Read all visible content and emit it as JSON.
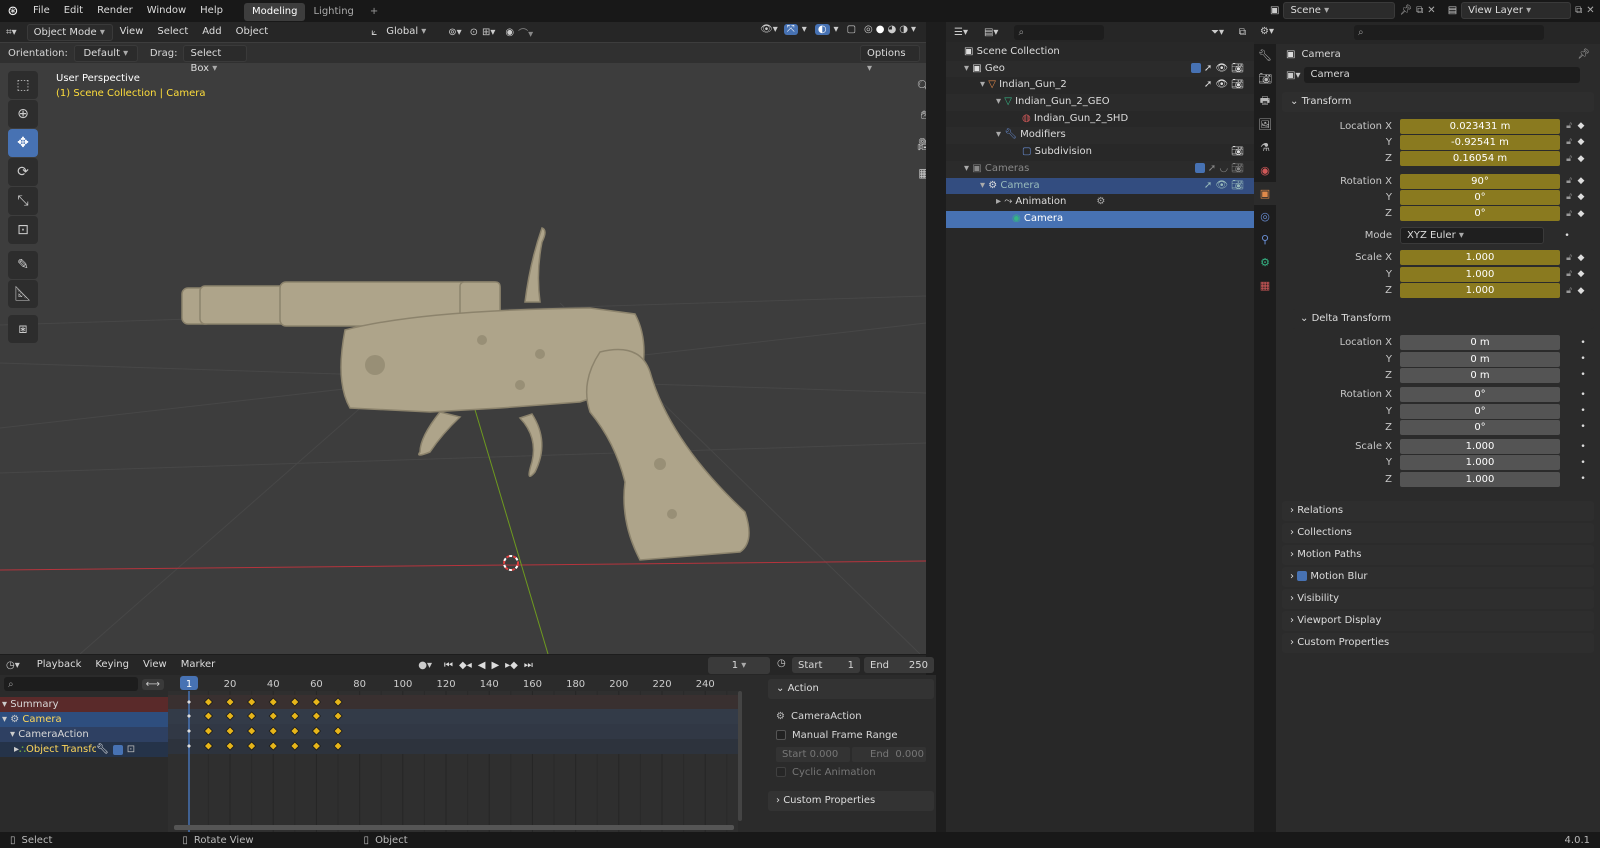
{
  "topbar": {
    "menus": [
      "File",
      "Edit",
      "Render",
      "Window",
      "Help"
    ],
    "tabs": [
      "Modeling",
      "Lighting"
    ],
    "add_tab": "+",
    "scene": "Scene",
    "view_layer": "View Layer"
  },
  "viewport": {
    "mode": "Object Mode",
    "menus": [
      "View",
      "Select",
      "Add",
      "Object"
    ],
    "transform_orientation": "Global",
    "orientation_label": "Orientation:",
    "orientation_value": "Default",
    "drag_label": "Drag:",
    "drag_value": "Select Box",
    "options": "Options",
    "overlay_title": "User Perspective",
    "overlay_sub_a": "(1) Scene Collection",
    "overlay_sub_sep": "|",
    "overlay_sub_b": "Camera"
  },
  "timeline": {
    "menus": [
      "Playback",
      "Keying",
      "View",
      "Marker"
    ],
    "current_frame": "1",
    "start_label": "Start",
    "start_value": "1",
    "end_label": "End",
    "end_value": "250",
    "ruler": [
      "20",
      "40",
      "60",
      "80",
      "100",
      "120",
      "140",
      "160",
      "180",
      "200",
      "220",
      "240"
    ],
    "playhead": "1",
    "channels": [
      "Summary",
      "Camera",
      "CameraAction",
      "Object Transforms"
    ],
    "action_panel": {
      "title": "Action",
      "action_name": "CameraAction",
      "manual_frame_range": "Manual Frame Range",
      "start_label": "Start",
      "start_value": "0.000",
      "end_label": "End",
      "end_value": "0.000",
      "cyclic": "Cyclic Animation",
      "custom_props": "Custom Properties"
    }
  },
  "outliner": {
    "rows": [
      {
        "label": "Scene Collection",
        "indent": 0
      },
      {
        "label": "Geo",
        "indent": 1
      },
      {
        "label": "Indian_Gun_2",
        "indent": 2
      },
      {
        "label": "Indian_Gun_2_GEO",
        "indent": 3
      },
      {
        "label": "Indian_Gun_2_SHD",
        "indent": 4
      },
      {
        "label": "Modifiers",
        "indent": 3
      },
      {
        "label": "Subdivision",
        "indent": 4
      },
      {
        "label": "Cameras",
        "indent": 1
      },
      {
        "label": "Camera",
        "indent": 2
      },
      {
        "label": "Animation",
        "indent": 3
      },
      {
        "label": "Camera",
        "indent": 3
      }
    ]
  },
  "properties": {
    "object_name": "Camera",
    "name_field": "Camera",
    "transform": {
      "title": "Transform",
      "location_label": "Location X",
      "location": [
        "0.023431 m",
        "-0.92541 m",
        "0.16054 m"
      ],
      "rotation_label": "Rotation X",
      "rotation": [
        "90°",
        "0°",
        "0°"
      ],
      "mode_label": "Mode",
      "mode": "XYZ Euler",
      "scale_label": "Scale X",
      "scale": [
        "1.000",
        "1.000",
        "1.000"
      ],
      "y": "Y",
      "z": "Z"
    },
    "delta": {
      "title": "Delta Transform",
      "location": [
        "0 m",
        "0 m",
        "0 m"
      ],
      "rotation": [
        "0°",
        "0°",
        "0°"
      ],
      "scale": [
        "1.000",
        "1.000",
        "1.000"
      ]
    },
    "sections": [
      "Relations",
      "Collections",
      "Motion Paths",
      "Motion Blur",
      "Visibility",
      "Viewport Display",
      "Custom Properties"
    ]
  },
  "status": {
    "select": "Select",
    "rotate": "Rotate View",
    "object": "Object",
    "version": "4.0.1"
  },
  "colors": {
    "accent": "#4772b3",
    "animated": "#8a7a1f",
    "keyframe": "#e6b51a",
    "x_axis": "#b5343d",
    "y_axis": "#6e9a1f"
  }
}
